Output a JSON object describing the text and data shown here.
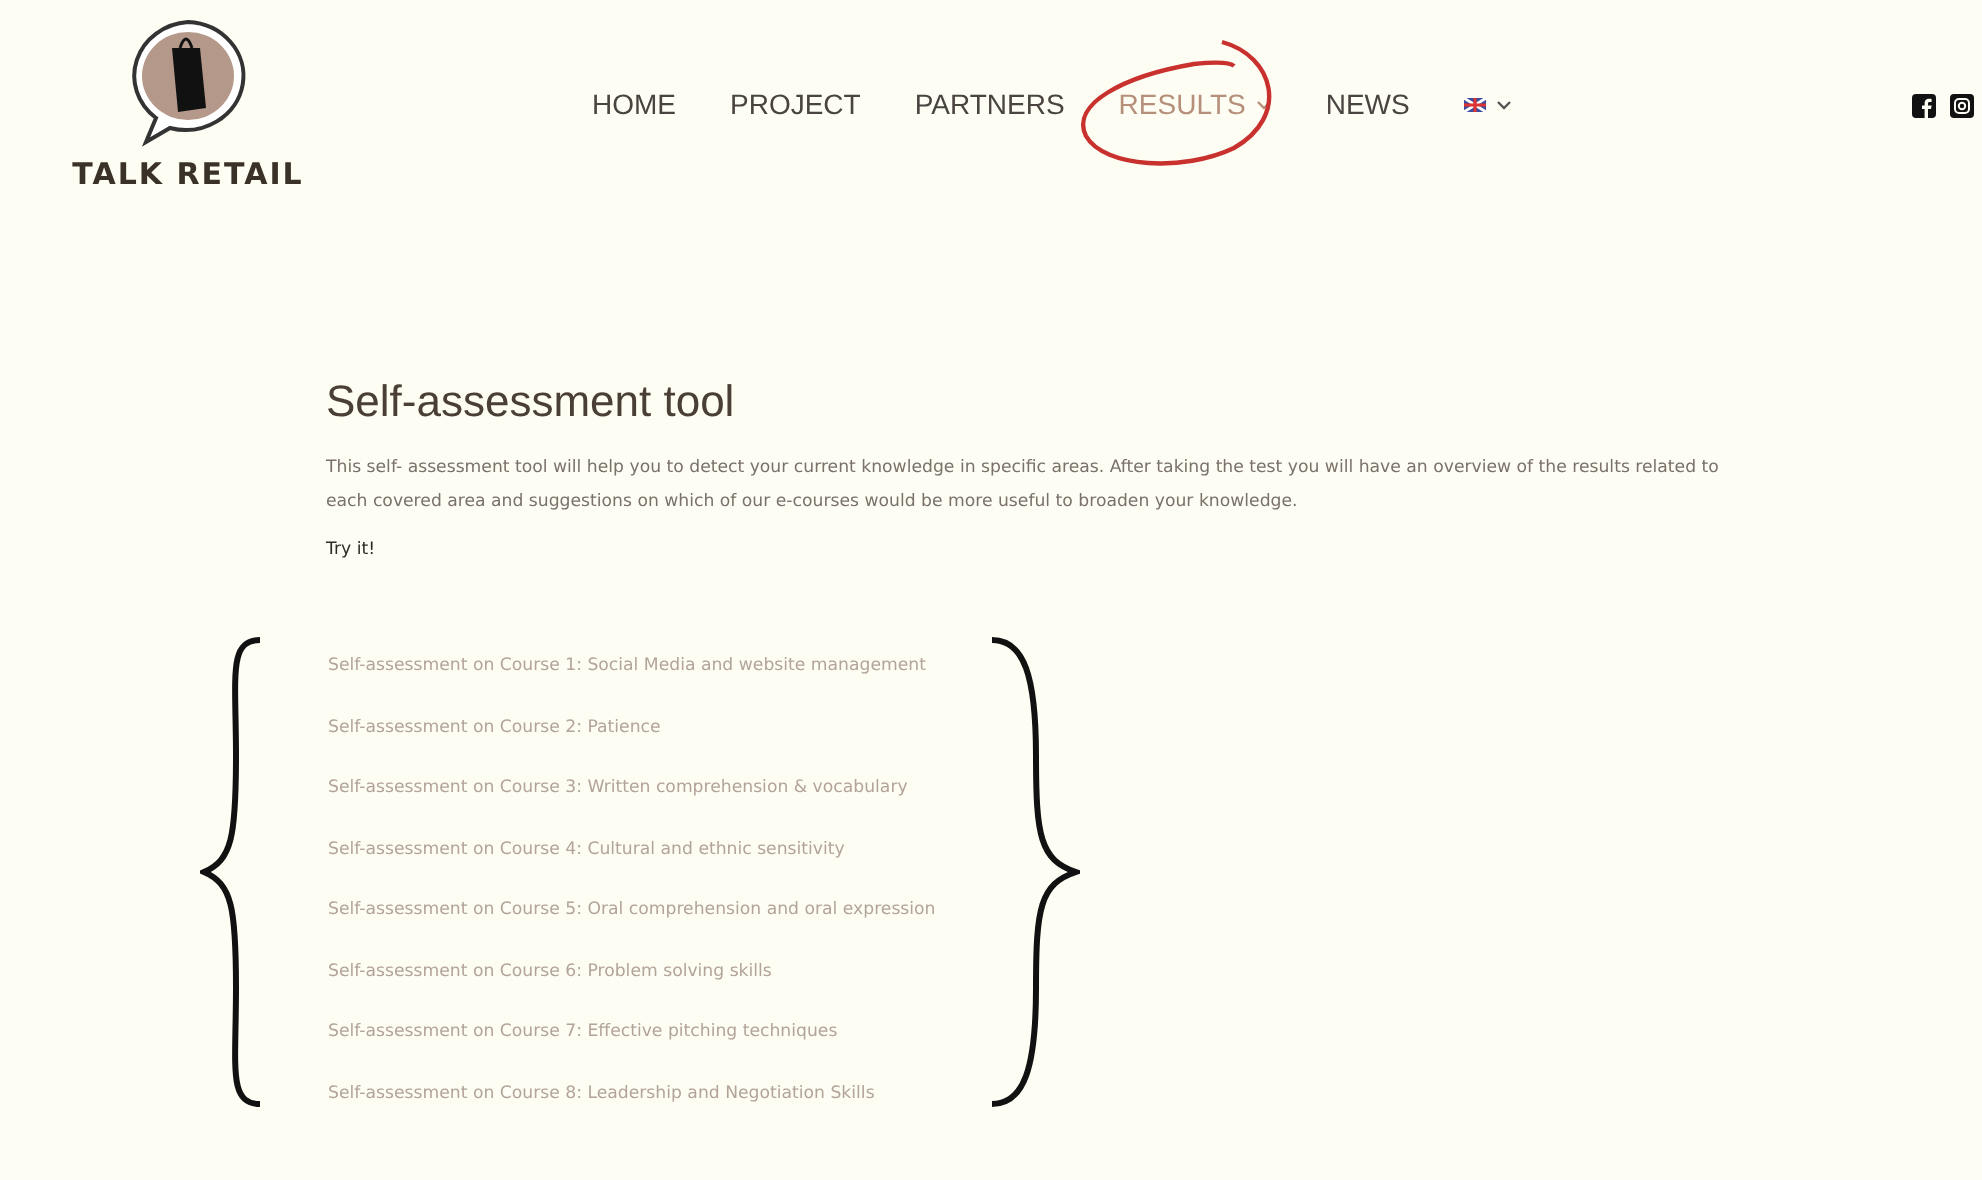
{
  "logo": {
    "text": "TALK RETAIL"
  },
  "nav": [
    {
      "label": "HOME",
      "selected": false,
      "has_dropdown": false,
      "circled": false
    },
    {
      "label": "PROJECT",
      "selected": false,
      "has_dropdown": false,
      "circled": false
    },
    {
      "label": "PARTNERS",
      "selected": false,
      "has_dropdown": false,
      "circled": false
    },
    {
      "label": "RESULTS",
      "selected": true,
      "has_dropdown": true,
      "circled": true
    },
    {
      "label": "NEWS",
      "selected": false,
      "has_dropdown": false,
      "circled": false
    }
  ],
  "language": {
    "has_dropdown": true
  },
  "heading": "Self-assessment tool",
  "intro": "This self- assessment tool will help you to detect your current knowledge in specific areas. After taking the test you will have an overview of the results related to each covered area and suggestions on which of our e-courses would be more useful to broaden your knowledge.",
  "cta": "Try it!",
  "links": [
    "Self-assessment on Course 1: Social Media and website management",
    "Self-assessment on  Course 2: Patience",
    "Self-assessment on  Course 3: Written comprehension & vocabulary",
    "Self-assessment on  Course 4: Cultural and ethnic sensitivity",
    "Self-assessment on Course 5: Oral comprehension and oral expression",
    "Self-assessment on Course 6: Problem solving skills",
    "Self-assessment on Course 7: Effective pitching techniques",
    "Self-assessment on Course 8: Leadership and Negotiation Skills"
  ]
}
